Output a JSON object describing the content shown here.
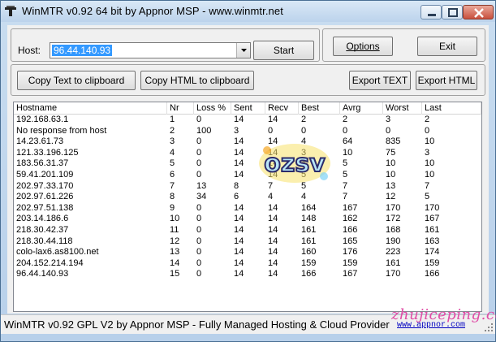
{
  "window": {
    "title": "WinMTR v0.92 64 bit by Appnor MSP - www.winmtr.net",
    "controls": [
      "minimize-icon",
      "maximize-icon",
      "close-icon"
    ]
  },
  "host_panel": {
    "host_label": "Host:",
    "host_value": "96.44.140.93",
    "start_label": "Start"
  },
  "options_panel": {
    "options_label": "Options",
    "exit_label": "Exit"
  },
  "export_bar": {
    "copy_text_label": "Copy Text to clipboard",
    "copy_html_label": "Copy HTML to clipboard",
    "export_text_label": "Export TEXT",
    "export_html_label": "Export HTML"
  },
  "table": {
    "columns": [
      "Hostname",
      "Nr",
      "Loss %",
      "Sent",
      "Recv",
      "Best",
      "Avrg",
      "Worst",
      "Last"
    ],
    "rows": [
      [
        "192.168.63.1",
        "1",
        "0",
        "14",
        "14",
        "2",
        "2",
        "3",
        "2"
      ],
      [
        "No response from host",
        "2",
        "100",
        "3",
        "0",
        "0",
        "0",
        "0",
        "0"
      ],
      [
        "14.23.61.73",
        "3",
        "0",
        "14",
        "14",
        "4",
        "64",
        "835",
        "10"
      ],
      [
        "121.33.196.125",
        "4",
        "0",
        "14",
        "14",
        "3",
        "10",
        "75",
        "3"
      ],
      [
        "183.56.31.37",
        "5",
        "0",
        "14",
        "14",
        "4",
        "5",
        "10",
        "10"
      ],
      [
        "59.41.201.109",
        "6",
        "0",
        "14",
        "14",
        "5",
        "5",
        "10",
        "10"
      ],
      [
        "202.97.33.170",
        "7",
        "13",
        "8",
        "7",
        "5",
        "7",
        "13",
        "7"
      ],
      [
        "202.97.61.226",
        "8",
        "34",
        "6",
        "4",
        "4",
        "7",
        "12",
        "5"
      ],
      [
        "202.97.51.138",
        "9",
        "0",
        "14",
        "14",
        "164",
        "167",
        "170",
        "170"
      ],
      [
        "203.14.186.6",
        "10",
        "0",
        "14",
        "14",
        "148",
        "162",
        "172",
        "167"
      ],
      [
        "218.30.42.37",
        "11",
        "0",
        "14",
        "14",
        "161",
        "166",
        "168",
        "161"
      ],
      [
        "218.30.44.118",
        "12",
        "0",
        "14",
        "14",
        "161",
        "165",
        "190",
        "163"
      ],
      [
        "colo-lax6.as8100.net",
        "13",
        "0",
        "14",
        "14",
        "160",
        "176",
        "223",
        "174"
      ],
      [
        "204.152.214.194",
        "14",
        "0",
        "14",
        "14",
        "159",
        "159",
        "161",
        "159"
      ],
      [
        "96.44.140.93",
        "15",
        "0",
        "14",
        "14",
        "166",
        "167",
        "170",
        "166"
      ]
    ]
  },
  "status_bar": {
    "text": "WinMTR v0.92 GPL V2 by Appnor MSP - Fully Managed Hosting & Cloud Provider",
    "link": "www.appnor.com"
  },
  "watermark": "zhujiceping.com",
  "stamp_text": "ozsv",
  "colors": {
    "selection": "#3399ff",
    "link": "#0000c0",
    "watermark": "#e04da6",
    "title_gradient_top": "#d9e8f6"
  }
}
